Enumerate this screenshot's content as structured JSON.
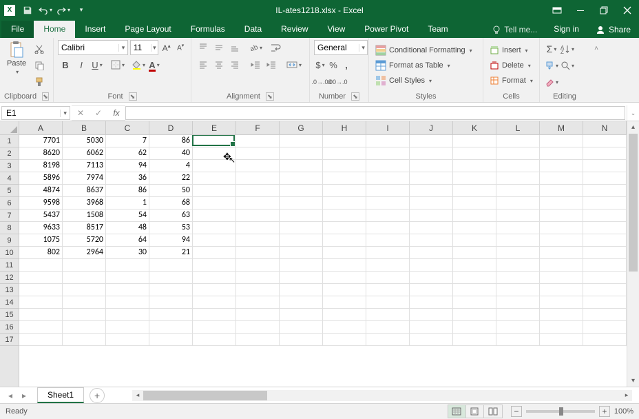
{
  "window": {
    "title": "IL-ates1218.xlsx - Excel"
  },
  "tabs": {
    "file": "File",
    "items": [
      "Home",
      "Insert",
      "Page Layout",
      "Formulas",
      "Data",
      "Review",
      "View",
      "Power Pivot",
      "Team"
    ],
    "active": "Home",
    "tellme": "Tell me...",
    "signin": "Sign in",
    "share": "Share"
  },
  "ribbon": {
    "clipboard": {
      "paste": "Paste",
      "label": "Clipboard"
    },
    "font": {
      "label": "Font",
      "name": "Calibri",
      "size": "11"
    },
    "alignment": {
      "label": "Alignment"
    },
    "number": {
      "label": "Number",
      "format": "General"
    },
    "styles": {
      "label": "Styles",
      "conditional": "Conditional Formatting",
      "table": "Format as Table",
      "cell": "Cell Styles"
    },
    "cells": {
      "label": "Cells",
      "insert": "Insert",
      "delete": "Delete",
      "format": "Format"
    },
    "editing": {
      "label": "Editing"
    }
  },
  "namebox": "E1",
  "columns": [
    "A",
    "B",
    "C",
    "D",
    "E",
    "F",
    "G",
    "H",
    "I",
    "J",
    "K",
    "L",
    "M",
    "N"
  ],
  "rows": [
    "1",
    "2",
    "3",
    "4",
    "5",
    "6",
    "7",
    "8",
    "9",
    "10",
    "11",
    "12",
    "13",
    "14",
    "15",
    "16",
    "17"
  ],
  "data": [
    [
      "7701",
      "5030",
      "7",
      "86",
      "",
      "",
      "",
      "",
      "",
      "",
      "",
      "",
      "",
      ""
    ],
    [
      "8620",
      "6062",
      "62",
      "40",
      "",
      "",
      "",
      "",
      "",
      "",
      "",
      "",
      "",
      ""
    ],
    [
      "8198",
      "7113",
      "94",
      "4",
      "",
      "",
      "",
      "",
      "",
      "",
      "",
      "",
      "",
      ""
    ],
    [
      "5896",
      "7974",
      "36",
      "22",
      "",
      "",
      "",
      "",
      "",
      "",
      "",
      "",
      "",
      ""
    ],
    [
      "4874",
      "8637",
      "86",
      "50",
      "",
      "",
      "",
      "",
      "",
      "",
      "",
      "",
      "",
      ""
    ],
    [
      "9598",
      "3968",
      "1",
      "68",
      "",
      "",
      "",
      "",
      "",
      "",
      "",
      "",
      "",
      ""
    ],
    [
      "5437",
      "1508",
      "54",
      "63",
      "",
      "",
      "",
      "",
      "",
      "",
      "",
      "",
      "",
      ""
    ],
    [
      "9633",
      "8517",
      "48",
      "53",
      "",
      "",
      "",
      "",
      "",
      "",
      "",
      "",
      "",
      ""
    ],
    [
      "1075",
      "5720",
      "64",
      "94",
      "",
      "",
      "",
      "",
      "",
      "",
      "",
      "",
      "",
      ""
    ],
    [
      "802",
      "2964",
      "30",
      "21",
      "",
      "",
      "",
      "",
      "",
      "",
      "",
      "",
      "",
      ""
    ],
    [
      "",
      "",
      "",
      "",
      "",
      "",
      "",
      "",
      "",
      "",
      "",
      "",
      "",
      ""
    ],
    [
      "",
      "",
      "",
      "",
      "",
      "",
      "",
      "",
      "",
      "",
      "",
      "",
      "",
      ""
    ],
    [
      "",
      "",
      "",
      "",
      "",
      "",
      "",
      "",
      "",
      "",
      "",
      "",
      "",
      ""
    ],
    [
      "",
      "",
      "",
      "",
      "",
      "",
      "",
      "",
      "",
      "",
      "",
      "",
      "",
      ""
    ],
    [
      "",
      "",
      "",
      "",
      "",
      "",
      "",
      "",
      "",
      "",
      "",
      "",
      "",
      ""
    ],
    [
      "",
      "",
      "",
      "",
      "",
      "",
      "",
      "",
      "",
      "",
      "",
      "",
      "",
      ""
    ],
    [
      "",
      "",
      "",
      "",
      "",
      "",
      "",
      "",
      "",
      "",
      "",
      "",
      "",
      ""
    ]
  ],
  "active_cell": {
    "row": 0,
    "col": 4
  },
  "sheet": {
    "name": "Sheet1"
  },
  "status": {
    "ready": "Ready",
    "zoom": "100%"
  }
}
